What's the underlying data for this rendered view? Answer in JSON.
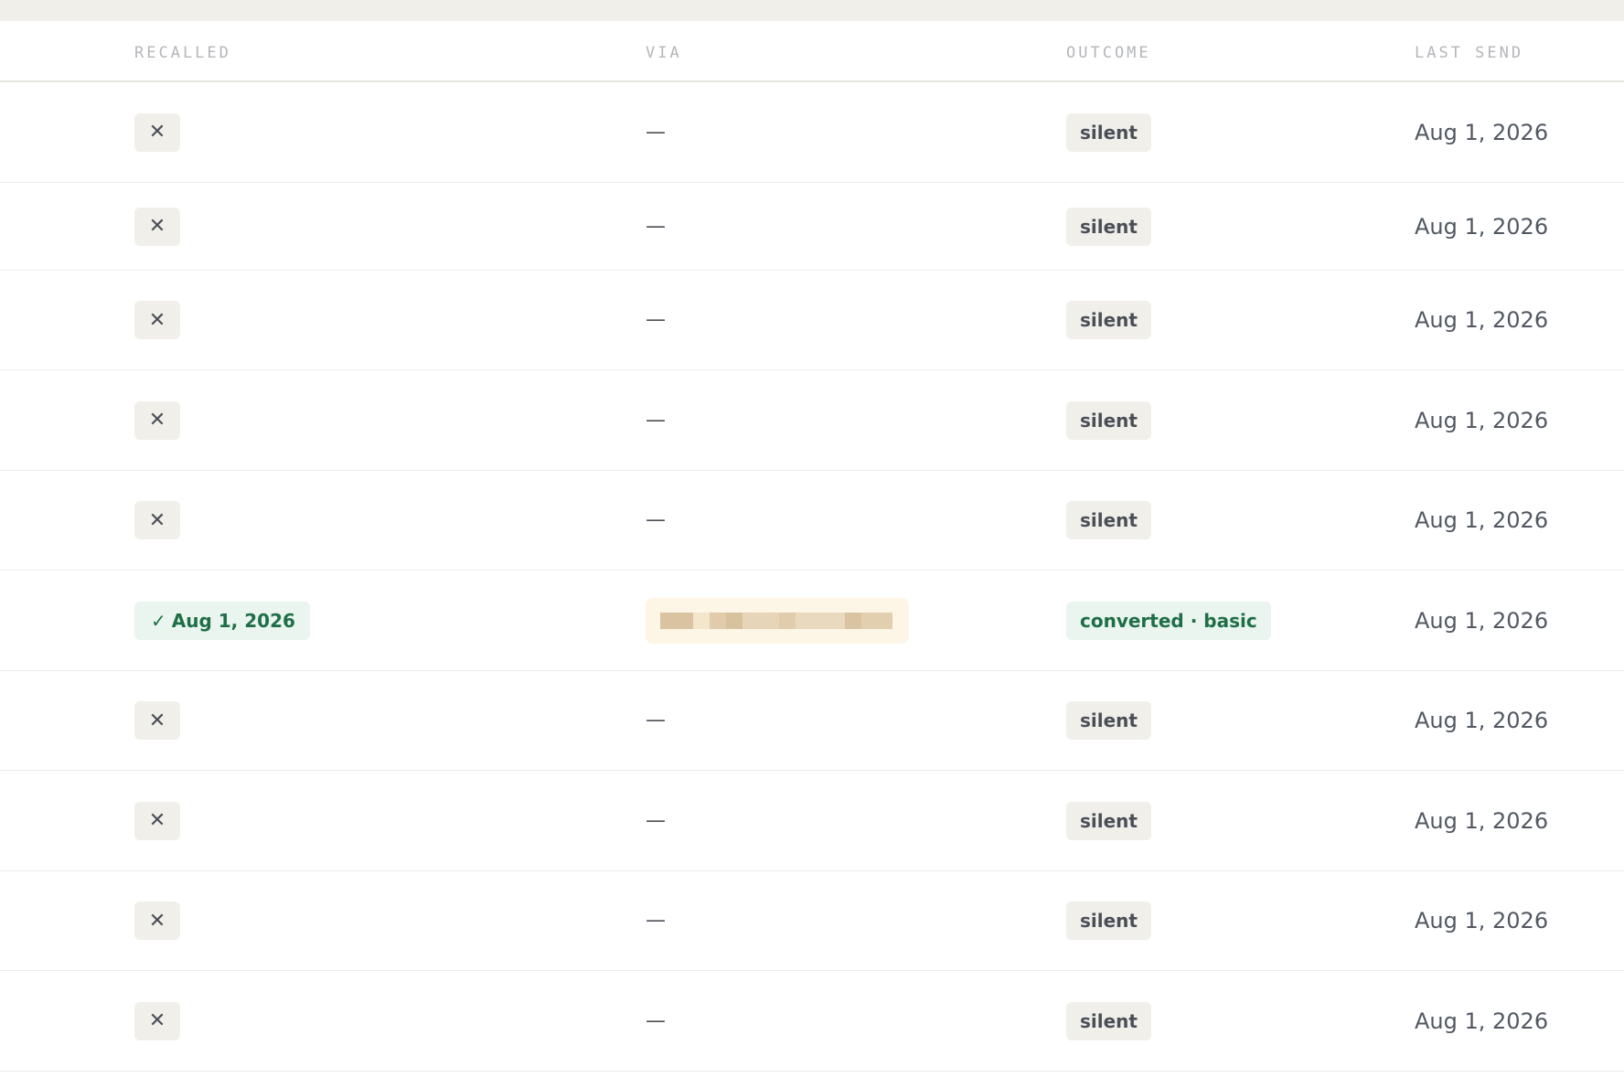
{
  "table": {
    "headers": {
      "recalled": "RECALLED",
      "via": "VIA",
      "outcome": "OUTCOME",
      "last_send": "LAST SEND"
    },
    "rows": [
      {
        "recalled": "✕",
        "recalled_ok": false,
        "via": "—",
        "outcome": "silent",
        "last_send": "Aug 1, 2026"
      },
      {
        "recalled": "✕",
        "recalled_ok": false,
        "via": "—",
        "outcome": "silent",
        "last_send": "Aug 1, 2026"
      },
      {
        "recalled": "✕",
        "recalled_ok": false,
        "via": "—",
        "outcome": "silent",
        "last_send": "Aug 1, 2026"
      },
      {
        "recalled": "✕",
        "recalled_ok": false,
        "via": "—",
        "outcome": "silent",
        "last_send": "Aug 1, 2026"
      },
      {
        "recalled": "✕",
        "recalled_ok": false,
        "via": "—",
        "outcome": "silent",
        "last_send": "Aug 1, 2026"
      },
      {
        "recalled": "Aug 1, 2026",
        "recalled_ok": true,
        "via": "",
        "via_redacted": true,
        "outcome": "converted · basic",
        "last_send": "Aug 1, 2026"
      },
      {
        "recalled": "✕",
        "recalled_ok": false,
        "via": "—",
        "outcome": "silent",
        "last_send": "Aug 1, 2026"
      },
      {
        "recalled": "✕",
        "recalled_ok": false,
        "via": "—",
        "outcome": "silent",
        "last_send": "Aug 1, 2026"
      },
      {
        "recalled": "✕",
        "recalled_ok": false,
        "via": "—",
        "outcome": "silent",
        "last_send": "Aug 1, 2026"
      },
      {
        "recalled": "✕",
        "recalled_ok": false,
        "via": "—",
        "outcome": "silent",
        "last_send": "Aug 1, 2026"
      }
    ]
  },
  "icons": {
    "recalled_no": "close-icon",
    "recalled_yes": "check-icon"
  },
  "colors": {
    "neutral_badge_bg": "#f1efea",
    "success_badge_bg": "#e9f5ee",
    "success_text": "#1f6e46",
    "body_text": "#4a4f57",
    "header_text": "#b4b6bb",
    "redacted_bg": "#fdf5e6"
  }
}
